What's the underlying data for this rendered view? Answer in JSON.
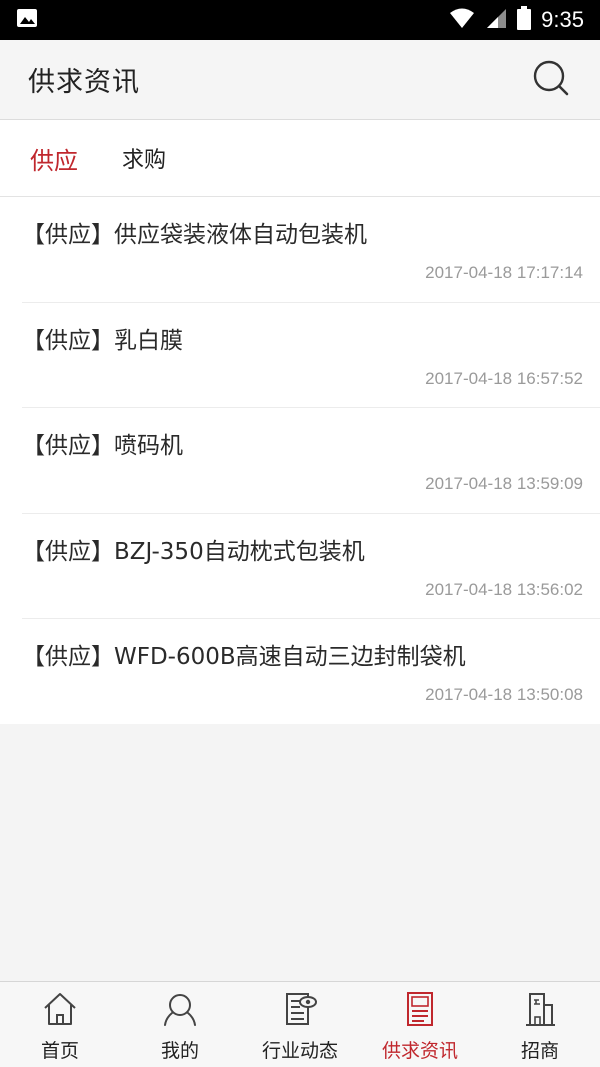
{
  "status_bar": {
    "time": "9:35",
    "icons": [
      "image-icon",
      "wifi-icon",
      "signal-icon",
      "battery-icon"
    ]
  },
  "app_bar": {
    "title": "供求资讯",
    "search_icon": "search-icon"
  },
  "tabs": [
    {
      "label": "供应",
      "active": true
    },
    {
      "label": "求购",
      "active": false
    }
  ],
  "items": [
    {
      "title": "【供应】供应袋装液体自动包装机",
      "time": "2017-04-18 17:17:14"
    },
    {
      "title": "【供应】乳白膜",
      "time": "2017-04-18 16:57:52"
    },
    {
      "title": "【供应】喷码机",
      "time": "2017-04-18 13:59:09"
    },
    {
      "title": "【供应】BZJ-350自动枕式包装机",
      "time": "2017-04-18 13:56:02"
    },
    {
      "title": "【供应】WFD-600B高速自动三边封制袋机",
      "time": "2017-04-18 13:50:08"
    }
  ],
  "bottom_nav": [
    {
      "label": "首页",
      "icon": "home-icon",
      "active": false
    },
    {
      "label": "我的",
      "icon": "user-icon",
      "active": false
    },
    {
      "label": "行业动态",
      "icon": "news-icon",
      "active": false
    },
    {
      "label": "供求资讯",
      "icon": "supply-icon",
      "active": true
    },
    {
      "label": "招商",
      "icon": "building-icon",
      "active": false
    }
  ],
  "colors": {
    "accent": "#c0272d",
    "text": "#222222",
    "muted": "#9a9a9a",
    "status_bar": "#000000"
  }
}
